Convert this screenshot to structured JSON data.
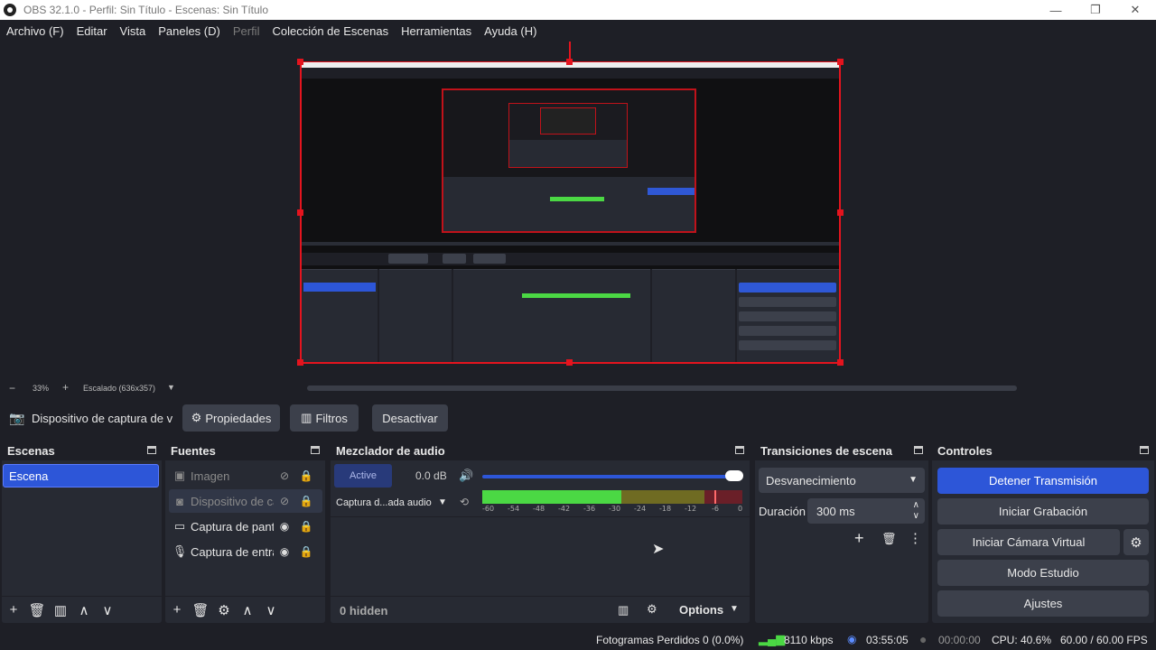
{
  "window": {
    "title": "OBS 32.1.0 - Perfil: Sin Título - Escenas: Sin Título"
  },
  "menu": [
    "Archivo (F)",
    "Editar",
    "Vista",
    "Paneles (D)",
    "Perfil",
    "Colección de Escenas",
    "Herramientas",
    "Ayuda (H)"
  ],
  "zoom": {
    "level": "33%",
    "scale_label": "Escalado (636x357)"
  },
  "source_toolbar": {
    "source_name": "Dispositivo de captura de v",
    "properties": "Propiedades",
    "filters": "Filtros",
    "deactivate": "Desactivar"
  },
  "scenes": {
    "title": "Escenas",
    "items": [
      "Escena"
    ]
  },
  "sources": {
    "title": "Fuentes",
    "items": [
      {
        "label": "Imagen",
        "icon": "image-icon"
      },
      {
        "label": "Dispositivo de ca",
        "icon": "camera-icon"
      },
      {
        "label": "Captura de pant",
        "icon": "monitor-icon"
      },
      {
        "label": "Captura de entra",
        "icon": "microphone-icon"
      }
    ]
  },
  "mixer": {
    "title": "Mezclador de audio",
    "active_label": "Active",
    "db": "0.0 dB",
    "channel_name": "Captura d...ada audio",
    "ticks": [
      "-60",
      "-54",
      "-48",
      "-42",
      "-36",
      "-30",
      "-24",
      "-18",
      "-12",
      "-6",
      "0"
    ],
    "hidden": "0 hidden",
    "options": "Options"
  },
  "transitions": {
    "title": "Transiciones de escena",
    "type": "Desvanecimiento",
    "duration_label": "Duración",
    "duration_value": "300 ms"
  },
  "controls": {
    "title": "Controles",
    "stop_stream": "Detener Transmisión",
    "start_record": "Iniciar Grabación",
    "start_virtualcam": "Iniciar Cámara Virtual",
    "studio_mode": "Modo Estudio",
    "settings": "Ajustes"
  },
  "status": {
    "dropped_frames": "Fotogramas Perdidos 0 (0.0%)",
    "bitrate": "8110 kbps",
    "stream_time": "03:55:05",
    "record_time": "00:00:00",
    "cpu": "CPU: 40.6%",
    "fps": "60.00 / 60.00 FPS"
  },
  "colors": {
    "accent": "#2d56d8",
    "selection_red": "#e4141e",
    "meter_green": "#4bd844"
  }
}
